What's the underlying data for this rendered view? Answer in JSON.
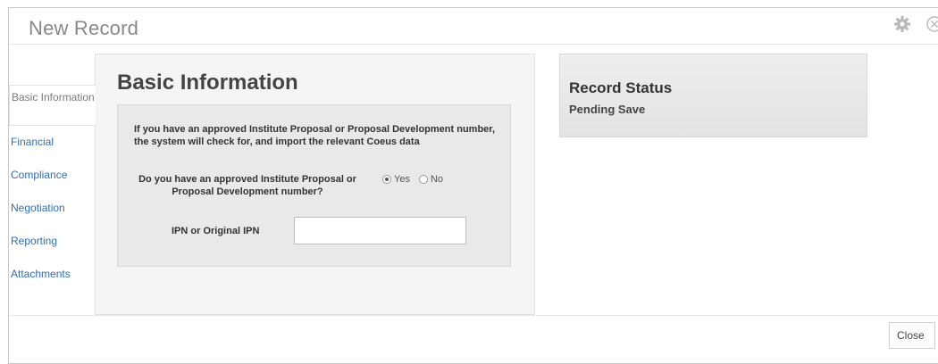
{
  "window": {
    "title": "New Record"
  },
  "header_icons": [
    "gear-icon",
    "close-icon"
  ],
  "sidebar": {
    "items": [
      {
        "label": "Basic Information",
        "active": true
      },
      {
        "label": "Financial"
      },
      {
        "label": "Compliance"
      },
      {
        "label": "Negotiation"
      },
      {
        "label": "Reporting"
      },
      {
        "label": "Attachments"
      }
    ]
  },
  "main": {
    "title": "Basic Information",
    "intro": "If you have an approved Institute Proposal or Proposal Development number, the system will check for, and import the relevant Coeus data",
    "question": "Do you have an approved Institute Proposal or Proposal Development number?",
    "options": {
      "yes": "Yes",
      "no": "No",
      "selected": "Yes"
    },
    "ipn_label": "IPN or Original IPN",
    "ipn_value": ""
  },
  "status": {
    "title": "Record Status",
    "value": "Pending Save"
  },
  "footer": {
    "close_label": "Close"
  },
  "colors": {
    "link": "#2f6fb2",
    "panel": "#f5f5f5",
    "inner": "#e9e9e9"
  }
}
